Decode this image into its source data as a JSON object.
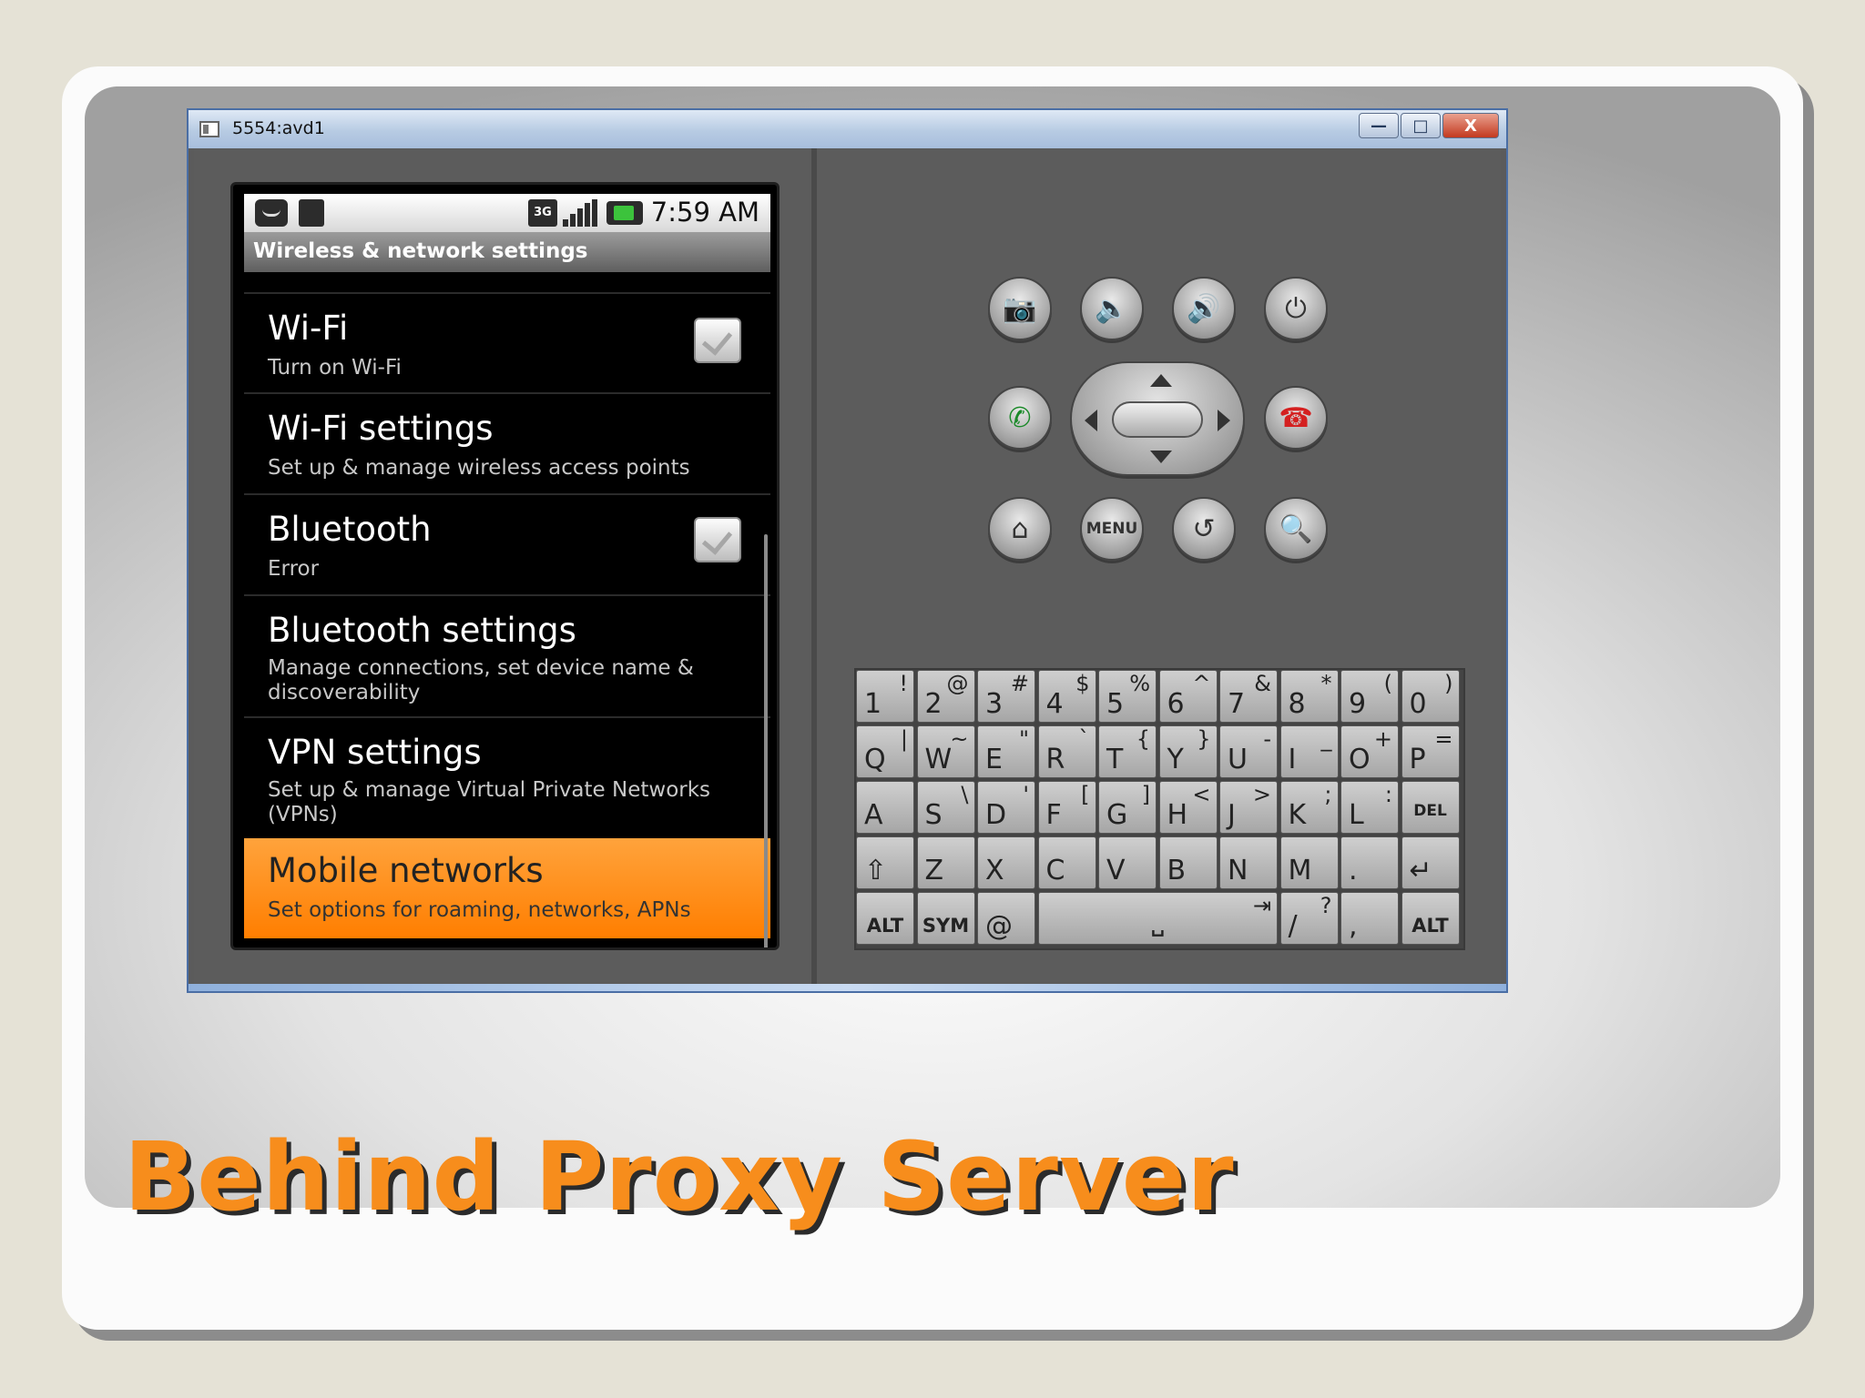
{
  "window": {
    "title": "5554:avd1",
    "buttons": [
      "—",
      "□",
      "X"
    ]
  },
  "status_bar": {
    "network_badge": "3G",
    "time": "7:59 AM",
    "icons": [
      "message-icon",
      "sd-card-icon",
      "3g-icon",
      "signal-icon",
      "battery-icon"
    ]
  },
  "screen": {
    "title": "Wireless & network settings",
    "settings": [
      {
        "title": "Wi-Fi",
        "summary": "Turn on Wi-Fi",
        "checkbox": true,
        "checked": true
      },
      {
        "title": "Wi-Fi settings",
        "summary": "Set up & manage wireless access points",
        "checkbox": false
      },
      {
        "title": "Bluetooth",
        "summary": "Error",
        "checkbox": true,
        "checked": true
      },
      {
        "title": "Bluetooth settings",
        "summary": "Manage connections, set device name & discoverability",
        "checkbox": false
      },
      {
        "title": "VPN settings",
        "summary": "Set up & manage Virtual Private Networks (VPNs)",
        "checkbox": false
      },
      {
        "title": "Mobile networks",
        "summary": "Set options for roaming, networks, APNs",
        "checkbox": false,
        "selected": true
      }
    ],
    "highlight_color": "#ff8c10"
  },
  "hardware_buttons": {
    "row1": [
      "camera-icon",
      "volume-down-icon",
      "volume-up-icon",
      "power-icon"
    ],
    "call": "call-icon",
    "end_call": "end-call-icon",
    "row3_home": "home-icon",
    "menu_label": "MENU",
    "row3_back": "back-icon",
    "row3_search": "search-icon",
    "call_color": "#1c8a2a",
    "end_call_color": "#d42020"
  },
  "keyboard": {
    "rows": [
      [
        [
          "1",
          "!"
        ],
        [
          "2",
          "@"
        ],
        [
          "3",
          "#"
        ],
        [
          "4",
          "$"
        ],
        [
          "5",
          "%"
        ],
        [
          "6",
          "^"
        ],
        [
          "7",
          "&"
        ],
        [
          "8",
          "*"
        ],
        [
          "9",
          "("
        ],
        [
          "0",
          ")"
        ]
      ],
      [
        [
          "Q",
          "|"
        ],
        [
          "W",
          "~"
        ],
        [
          "E",
          "\""
        ],
        [
          "R",
          "`"
        ],
        [
          "T",
          "{"
        ],
        [
          "Y",
          "}"
        ],
        [
          "U",
          "-"
        ],
        [
          "I",
          "_"
        ],
        [
          "O",
          "+"
        ],
        [
          "P",
          "="
        ]
      ],
      [
        [
          "A",
          ""
        ],
        [
          "S",
          "\\"
        ],
        [
          "D",
          "'"
        ],
        [
          "F",
          "["
        ],
        [
          "G",
          "]"
        ],
        [
          "H",
          "<"
        ],
        [
          "J",
          ">"
        ],
        [
          "K",
          ";"
        ],
        [
          "L",
          ":"
        ],
        [
          "DEL",
          ""
        ]
      ],
      [
        [
          "⇧",
          ""
        ],
        [
          "Z",
          ""
        ],
        [
          "X",
          ""
        ],
        [
          "C",
          ""
        ],
        [
          "V",
          ""
        ],
        [
          "B",
          ""
        ],
        [
          "N",
          ""
        ],
        [
          "M",
          ""
        ],
        [
          ".",
          ""
        ],
        [
          "↵",
          ""
        ]
      ]
    ],
    "bottom": {
      "alt_left": "ALT",
      "sym": "SYM",
      "at": "@",
      "space": "␣",
      "tab": "⇥",
      "slash": "/",
      "question": "?",
      "comma": ",",
      "alt_right": "ALT"
    }
  },
  "slide_title": "Behind Proxy Server",
  "slide_title_color": "#f78d1c"
}
